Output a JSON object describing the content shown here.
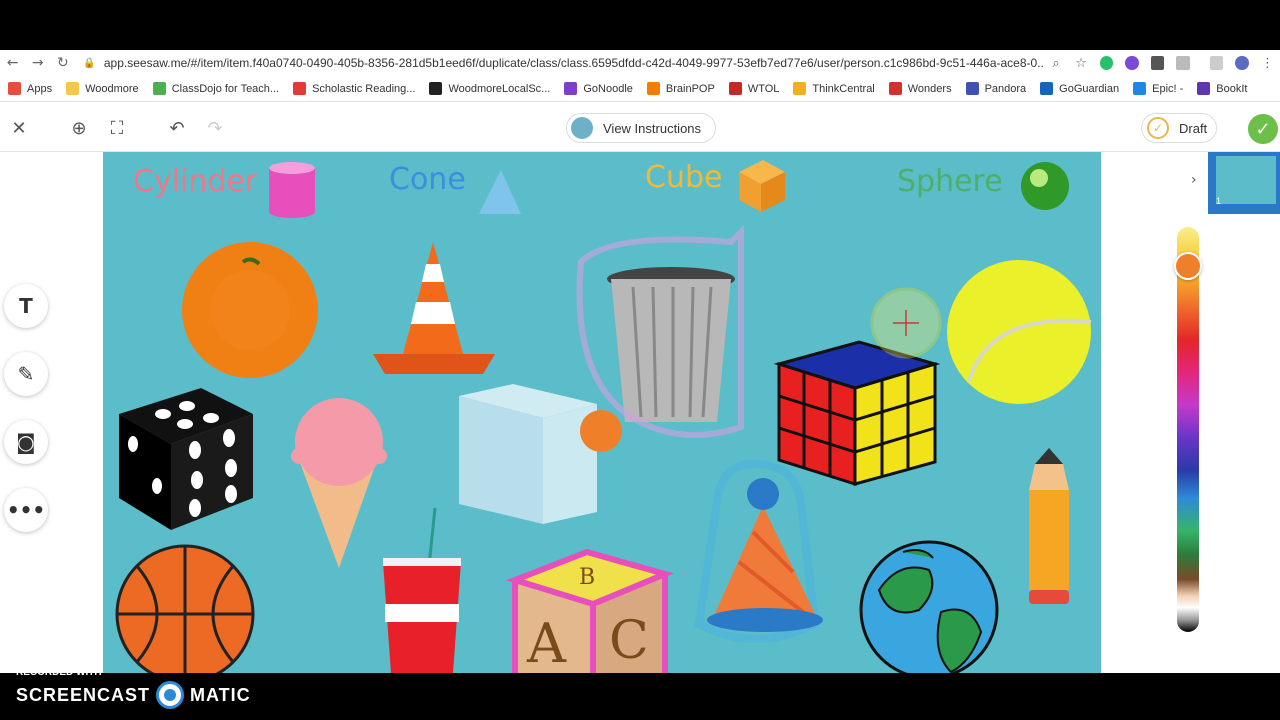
{
  "browser": {
    "url": "app.seesaw.me/#/item/item.f40a0740-0490-405b-8356-281d5b1eed6f/duplicate/class/class.6595dfdd-c42d-4049-9977-53efb7ed77e6/user/person.c1c986bd-9c51-446a-ace8-0...",
    "bookmarks": [
      {
        "label": "Apps",
        "color": "#e84c3c"
      },
      {
        "label": "Woodmore",
        "color": "#f2c94c"
      },
      {
        "label": "ClassDojo for Teach...",
        "color": "#4caf50"
      },
      {
        "label": "Scholastic Reading...",
        "color": "#e53935"
      },
      {
        "label": "WoodmoreLocalSc...",
        "color": "#222222"
      },
      {
        "label": "GoNoodle",
        "color": "#7b3fc9"
      },
      {
        "label": "BrainPOP",
        "color": "#f57c00"
      },
      {
        "label": "WTOL",
        "color": "#c62828"
      },
      {
        "label": "ThinkCentral",
        "color": "#f2b01e"
      },
      {
        "label": "Wonders",
        "color": "#d32f2f"
      },
      {
        "label": "Pandora",
        "color": "#3f51b5"
      },
      {
        "label": "GoGuardian",
        "color": "#1565c0"
      },
      {
        "label": "Epic! -",
        "color": "#1e88e5"
      },
      {
        "label": "BookIt",
        "color": "#5e35b1"
      }
    ]
  },
  "toolbar": {
    "view_instructions": "View Instructions",
    "draft": "Draft"
  },
  "canvas": {
    "shape_labels": [
      {
        "text": "Cylinder",
        "color": "#f2768a"
      },
      {
        "text": "Cone",
        "color": "#3d8de0"
      },
      {
        "text": "Cube",
        "color": "#f0b93a"
      },
      {
        "text": "Sphere",
        "color": "#4caf6a"
      }
    ],
    "blocks_letters": [
      "A",
      "C",
      "B"
    ]
  },
  "panel": {
    "page_number": "1",
    "selected_color": "#f07f2a"
  },
  "watermark": {
    "small": "RECORDED WITH",
    "left": "SCREENCAST",
    "right": "MATIC"
  }
}
